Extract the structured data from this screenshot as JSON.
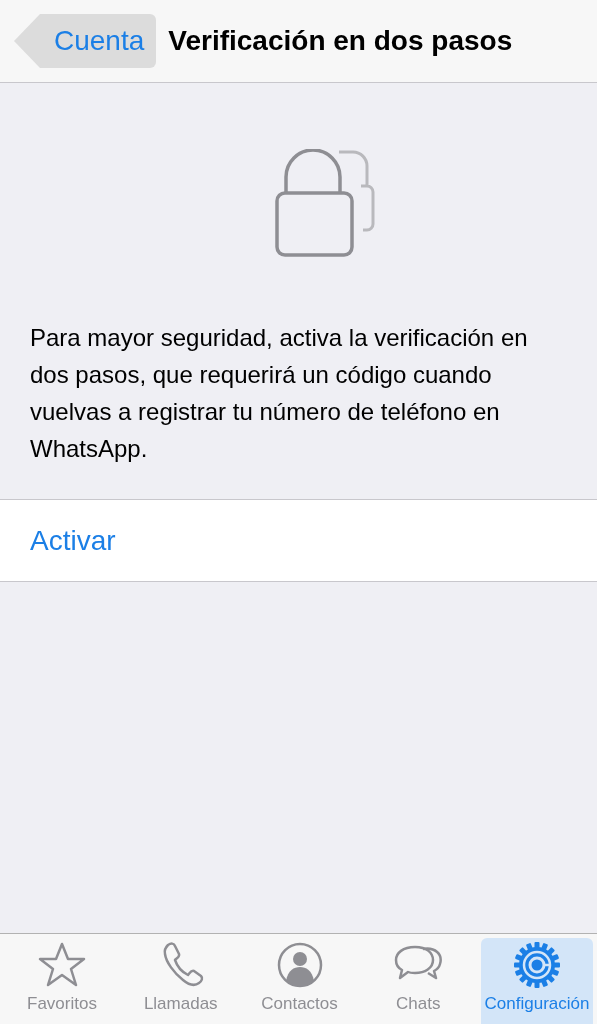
{
  "nav_bar": {
    "back": "Cuenta",
    "title": "Verificación en dos pasos"
  },
  "description": "Para mayor seguridad, activa la verificación en dos pasos, que requerirá un código cuando vuelvas a registrar tu número de teléfono en WhatsApp.",
  "action": "Activar",
  "tab_bar": [
    {
      "kind": "star",
      "label": "Favoritos",
      "selected": false
    },
    {
      "kind": "phone",
      "label": "Llamadas",
      "selected": false
    },
    {
      "kind": "contact",
      "label": "Contactos",
      "selected": false
    },
    {
      "kind": "chats",
      "label": "Chats",
      "selected": false
    },
    {
      "kind": "gear",
      "label": "Configuración",
      "selected": true
    }
  ]
}
